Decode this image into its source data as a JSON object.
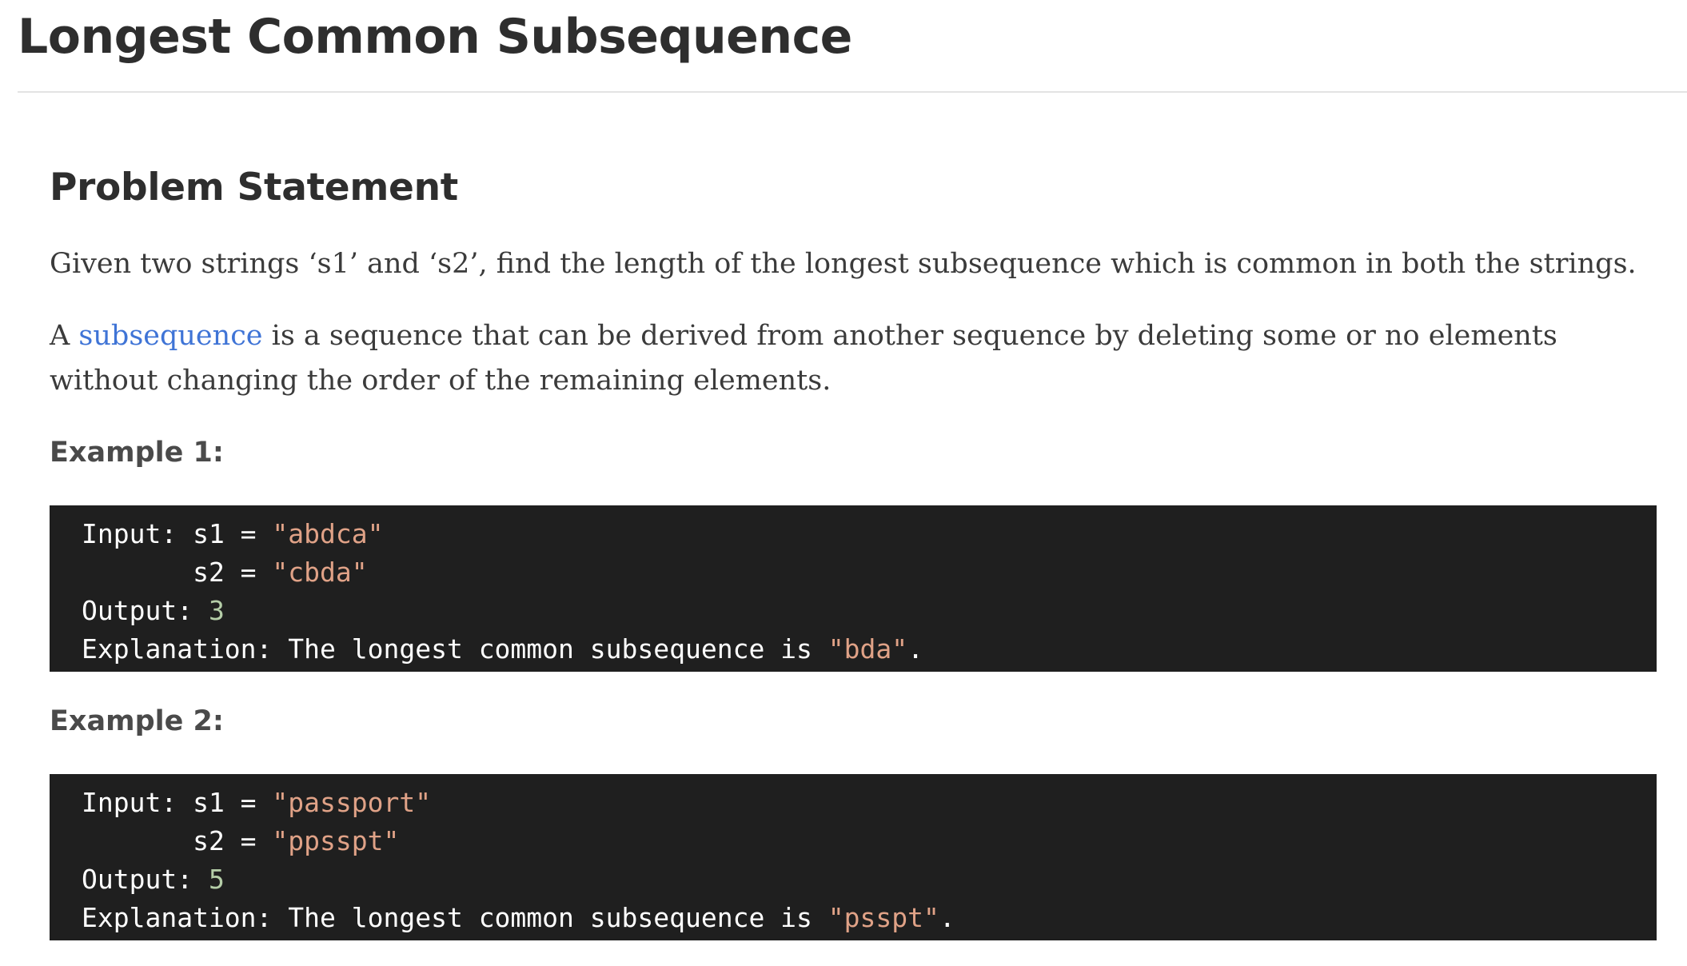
{
  "page": {
    "title": "Longest Common Subsequence"
  },
  "problem": {
    "heading": "Problem Statement",
    "paragraph1": "Given two strings ‘s1’ and ‘s2’, find the length of the longest subsequence which is common in both the strings.",
    "paragraph2": {
      "prefix": "A ",
      "link_text": "subsequence",
      "suffix": " is a sequence that can be derived from another sequence by deleting some or no elements without changing the order of the remaining elements."
    }
  },
  "examples": [
    {
      "heading": "Example 1:",
      "input_label": "Input: s1 = ",
      "s1": "\"abdca\"",
      "s2_label": "       s2 = ",
      "s2": "\"cbda\"",
      "output_label": "Output: ",
      "output": "3",
      "explanation_label": "Explanation: The longest common subsequence is ",
      "explanation_value": "\"bda\"",
      "explanation_end": "."
    },
    {
      "heading": "Example 2:",
      "input_label": "Input: s1 = ",
      "s1": "\"passport\"",
      "s2_label": "       s2 = ",
      "s2": "\"ppsspt\"",
      "output_label": "Output: ",
      "output": "5",
      "explanation_label": "Explanation: The longest common subsequence is ",
      "explanation_value": "\"psspt\"",
      "explanation_end": "."
    }
  ],
  "colors": {
    "code_background": "#1f1f1f",
    "code_string": "#e0a287",
    "code_number": "#b5cea8",
    "link": "#3f74d6"
  }
}
